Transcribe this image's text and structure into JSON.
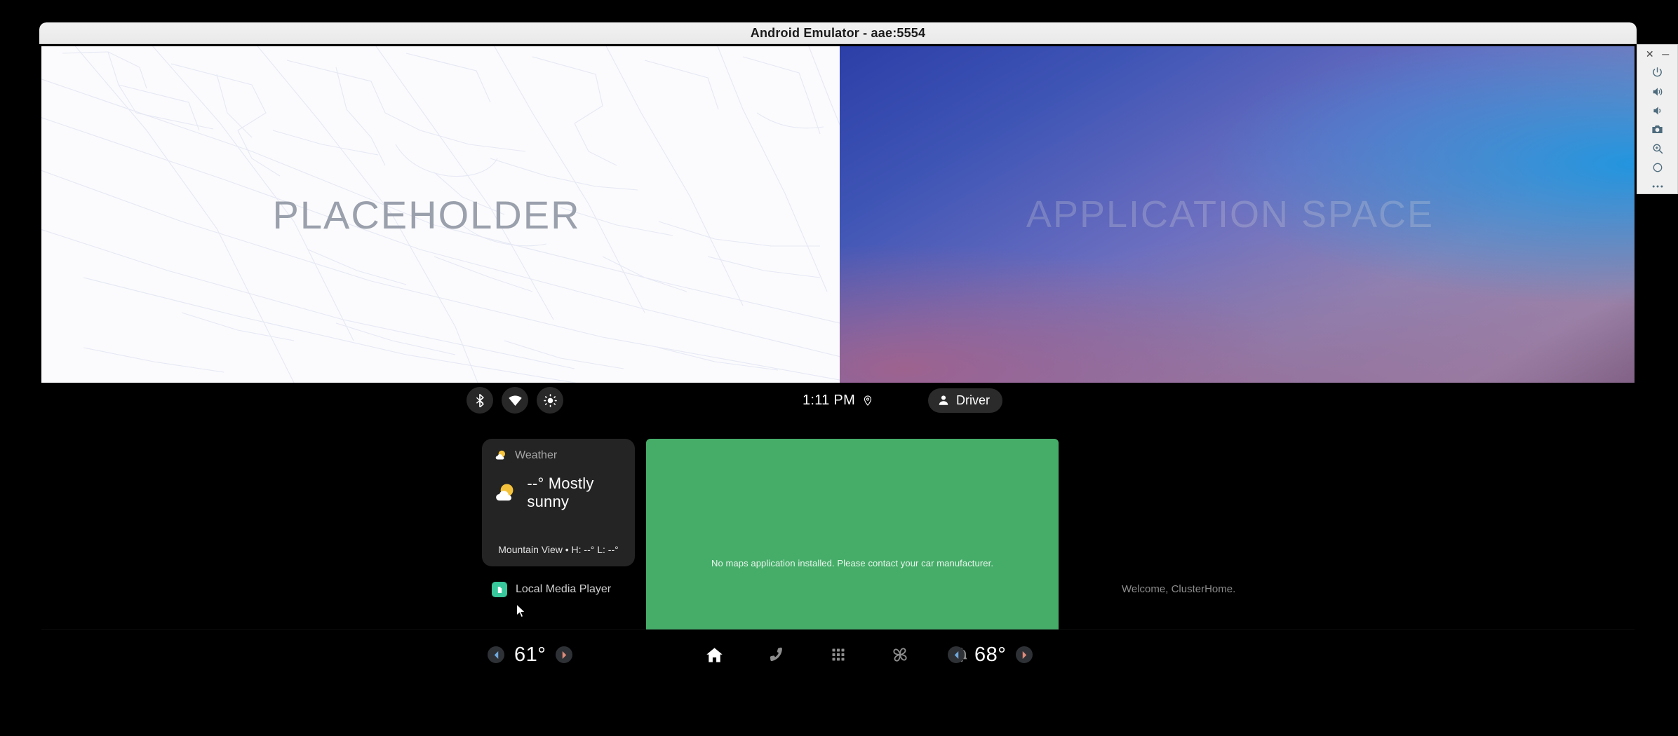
{
  "window": {
    "title": "Android Emulator - aae:5554",
    "close_icon": "close-icon",
    "minimize_icon": "minimize-icon"
  },
  "top_region": {
    "map_placeholder_label": "PLACEHOLDER",
    "app_space_label": "APPLICATION SPACE"
  },
  "status_bar": {
    "quick_controls": [
      {
        "name": "bluetooth-icon",
        "label": "Bluetooth"
      },
      {
        "name": "wifi-icon",
        "label": "Wi-Fi"
      },
      {
        "name": "brightness-icon",
        "label": "Brightness"
      }
    ],
    "clock": "1:11 PM",
    "location_icon": "location-pin-icon",
    "user_chip": {
      "label": "Driver",
      "icon": "user-avatar-icon"
    }
  },
  "home": {
    "weather_card": {
      "header_label": "Weather",
      "header_icon": "partly-sunny-icon",
      "condition_icon": "partly-sunny-icon",
      "condition": "--° Mostly sunny",
      "footer": "Mountain View • H: --° L: --°"
    },
    "media_item": {
      "label": "Local Media Player",
      "icon": "media-app-icon"
    },
    "map_card": {
      "message": "No maps application installed. Please contact your car manufacturer.",
      "background_color": "#46ad69"
    },
    "welcome_text": "Welcome, ClusterHome."
  },
  "nav_bar": {
    "temp_left": {
      "value": "61°",
      "decrease_icon": "chevron-left-icon",
      "increase_icon": "chevron-right-icon",
      "decrease_color": "#6fa8dc",
      "increase_color": "#e08a7a"
    },
    "temp_right": {
      "value": "68°",
      "decrease_icon": "chevron-left-icon",
      "increase_icon": "chevron-right-icon",
      "decrease_color": "#6fa8dc",
      "increase_color": "#e08a7a"
    },
    "items": [
      {
        "name": "home-icon",
        "label": "Home",
        "active": true
      },
      {
        "name": "phone-icon",
        "label": "Phone",
        "active": false
      },
      {
        "name": "apps-grid-icon",
        "label": "Apps",
        "active": false
      },
      {
        "name": "climate-fan-icon",
        "label": "Climate",
        "active": false
      },
      {
        "name": "notifications-bell-icon",
        "label": "Notifications",
        "active": false
      }
    ]
  },
  "side_toolbar": {
    "items": [
      {
        "name": "power-icon",
        "label": "Power"
      },
      {
        "name": "volume-up-icon",
        "label": "Volume Up"
      },
      {
        "name": "volume-down-icon",
        "label": "Volume Down"
      },
      {
        "name": "screenshot-camera-icon",
        "label": "Take Screenshot"
      },
      {
        "name": "zoom-icon",
        "label": "Zoom"
      },
      {
        "name": "circle-button-icon",
        "label": "Home Button"
      },
      {
        "name": "more-icon",
        "label": "More"
      }
    ]
  },
  "colors": {
    "accent_green": "#46ad69",
    "panel_dark": "#242424",
    "cool_blue": "#6fa8dc",
    "warm_red": "#e08a7a",
    "media_teal": "#37c79b"
  }
}
